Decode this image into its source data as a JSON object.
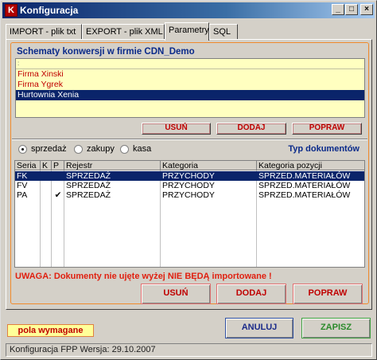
{
  "window": {
    "title": "Konfiguracja",
    "icon_letter": "K",
    "controls": {
      "minimize": "_",
      "maximize": "□",
      "close": "×"
    }
  },
  "tabs": [
    {
      "label": "IMPORT - plik txt"
    },
    {
      "label": "EXPORT - plik XML"
    },
    {
      "label": "Parametry"
    },
    {
      "label": "SQL"
    }
  ],
  "schemas": {
    "title": "Schematy konwersji w firmie CDN_Demo",
    "header": ":",
    "items": [
      {
        "label": "Firma Xinski"
      },
      {
        "label": "Firma Ygrek"
      },
      {
        "label": "Hurtownia Xenia"
      }
    ],
    "buttons": {
      "delete": "USUŃ",
      "add": "DODAJ",
      "edit": "POPRAW"
    }
  },
  "doc_filter": {
    "options": [
      {
        "label": "sprzedaż",
        "selected": true
      },
      {
        "label": "zakupy",
        "selected": false
      },
      {
        "label": "kasa",
        "selected": false
      }
    ],
    "label": "Typ dokumentów"
  },
  "grid": {
    "columns": [
      "Seria",
      "K",
      "P",
      "Rejestr",
      "Kategoria",
      "Kategoria pozycji"
    ],
    "rows": [
      {
        "seria": "FK",
        "k": "",
        "p": "",
        "rejestr": "SPRZEDAŻ",
        "kategoria": "PRZYCHODY",
        "kategoria_pozycji": "SPRZED.MATERIAŁÓW"
      },
      {
        "seria": "FV",
        "k": "",
        "p": "",
        "rejestr": "SPRZEDAŻ",
        "kategoria": "PRZYCHODY",
        "kategoria_pozycji": "SPRZED.MATERIAŁÓW"
      },
      {
        "seria": "PA",
        "k": "",
        "p": "✔",
        "rejestr": "SPRZEDAŻ",
        "kategoria": "PRZYCHODY",
        "kategoria_pozycji": "SPRZED.MATERIAŁÓW"
      }
    ]
  },
  "warning": "UWAGA: Dokumenty nie ujęte wyżej NIE BĘDĄ importowane !",
  "doc_buttons": {
    "delete": "USUŃ",
    "add": "DODAJ",
    "edit": "POPRAW"
  },
  "required_label": "pola wymagane",
  "actions": {
    "cancel": "ANULUJ",
    "save": "ZAPISZ"
  },
  "status": "Konfiguracja FPP Wersja: 29.10.2007",
  "colors": {
    "accent_red": "#c00000",
    "title_blue": "#0a2a8a",
    "selection": "#0a246a",
    "list_bg": "#ffffc0",
    "save_green": "#2a8a2a",
    "cancel_blue": "#1a2a8a"
  }
}
